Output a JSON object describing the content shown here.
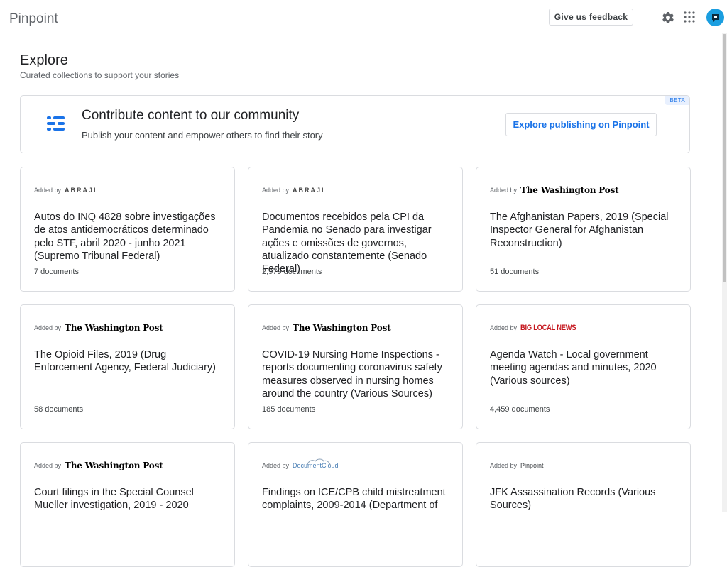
{
  "app": {
    "name": "Pinpoint"
  },
  "header": {
    "feedback_label": "Give us feedback",
    "settings_icon": "gear-icon",
    "apps_icon": "apps-grid-icon",
    "avatar_icon": "user-avatar"
  },
  "page": {
    "title": "Explore",
    "subtitle": "Curated collections to support your stories"
  },
  "banner": {
    "title": "Contribute content to our community",
    "text": "Publish your content and empower others to find their story",
    "badge": "BETA",
    "button_label": "Explore publishing on Pinpoint"
  },
  "added_by_label": "Added by",
  "cards": [
    {
      "publisher": "ABRAJI",
      "title": "Autos do INQ 4828 sobre investigações de atos antidemocráticos determinado pelo STF, abril 2020 - junho 2021 (Supremo Tribunal Federal)",
      "count": "7 documents"
    },
    {
      "publisher": "ABRAJI",
      "title": "Documentos recebidos pela CPI da Pandemia no Senado para investigar ações e omissões de governos, atualizado constantemente (Senado Federal)",
      "count": "2,979 documents"
    },
    {
      "publisher": "The Washington Post",
      "title": "The Afghanistan Papers, 2019 (Special Inspector General for Afghanistan Reconstruction)",
      "count": "51 documents"
    },
    {
      "publisher": "The Washington Post",
      "title": "The Opioid Files, 2019 (Drug Enforcement Agency, Federal Judiciary)",
      "count": "58 documents"
    },
    {
      "publisher": "The Washington Post",
      "title": "COVID-19 Nursing Home Inspections - reports documenting coronavirus safety measures observed in nursing homes around the country (Various Sources)",
      "count": "185 documents"
    },
    {
      "publisher": "BIG LOCAL NEWS",
      "title": "Agenda Watch - Local government meeting agendas and minutes, 2020 (Various sources)",
      "count": "4,459 documents"
    },
    {
      "publisher": "The Washington Post",
      "title": "Court filings in the Special Counsel Mueller investigation, 2019 - 2020",
      "count": ""
    },
    {
      "publisher": "DocumentCloud",
      "title": "Findings on ICE/CPB child mistreatment complaints, 2009-2014 (Department of",
      "count": ""
    },
    {
      "publisher": "Pinpoint",
      "title": "JFK Assassination Records (Various Sources)",
      "count": ""
    }
  ],
  "colors": {
    "accent": "#1a73e8",
    "border": "#dadce0",
    "avatar": "#1a9ee0",
    "big_local_news": "#c5161d"
  }
}
